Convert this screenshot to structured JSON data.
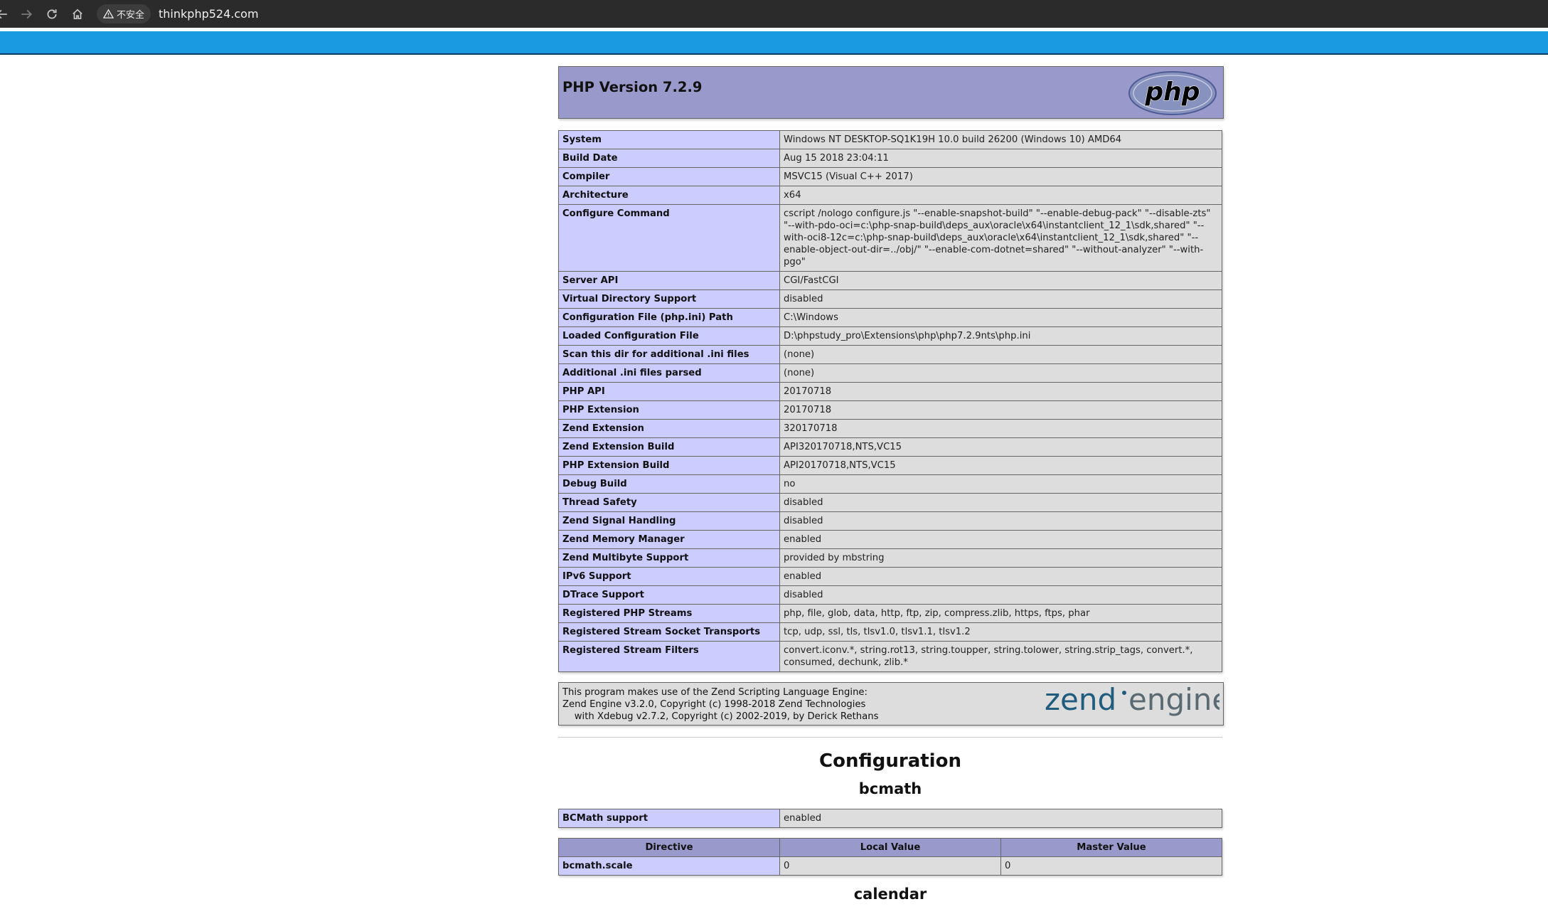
{
  "browser": {
    "security_label": "不安全",
    "url": "thinkphp524.com"
  },
  "header": {
    "title": "PHP Version 7.2.9",
    "logo_text": "php"
  },
  "system_rows": [
    {
      "key": "System",
      "value": "Windows NT DESKTOP-SQ1K19H 10.0 build 26200 (Windows 10) AMD64"
    },
    {
      "key": "Build Date",
      "value": "Aug 15 2018 23:04:11"
    },
    {
      "key": "Compiler",
      "value": "MSVC15 (Visual C++ 2017)"
    },
    {
      "key": "Architecture",
      "value": "x64"
    },
    {
      "key": "Configure Command",
      "value": "cscript /nologo configure.js \"--enable-snapshot-build\" \"--enable-debug-pack\" \"--disable-zts\" \"--with-pdo-oci=c:\\php-snap-build\\deps_aux\\oracle\\x64\\instantclient_12_1\\sdk,shared\" \"--with-oci8-12c=c:\\php-snap-build\\deps_aux\\oracle\\x64\\instantclient_12_1\\sdk,shared\" \"--enable-object-out-dir=../obj/\" \"--enable-com-dotnet=shared\" \"--without-analyzer\" \"--with-pgo\""
    },
    {
      "key": "Server API",
      "value": "CGI/FastCGI"
    },
    {
      "key": "Virtual Directory Support",
      "value": "disabled"
    },
    {
      "key": "Configuration File (php.ini) Path",
      "value": "C:\\Windows"
    },
    {
      "key": "Loaded Configuration File",
      "value": "D:\\phpstudy_pro\\Extensions\\php\\php7.2.9nts\\php.ini"
    },
    {
      "key": "Scan this dir for additional .ini files",
      "value": "(none)"
    },
    {
      "key": "Additional .ini files parsed",
      "value": "(none)"
    },
    {
      "key": "PHP API",
      "value": "20170718"
    },
    {
      "key": "PHP Extension",
      "value": "20170718"
    },
    {
      "key": "Zend Extension",
      "value": "320170718"
    },
    {
      "key": "Zend Extension Build",
      "value": "API320170718,NTS,VC15"
    },
    {
      "key": "PHP Extension Build",
      "value": "API20170718,NTS,VC15"
    },
    {
      "key": "Debug Build",
      "value": "no"
    },
    {
      "key": "Thread Safety",
      "value": "disabled"
    },
    {
      "key": "Zend Signal Handling",
      "value": "disabled"
    },
    {
      "key": "Zend Memory Manager",
      "value": "enabled"
    },
    {
      "key": "Zend Multibyte Support",
      "value": "provided by mbstring"
    },
    {
      "key": "IPv6 Support",
      "value": "enabled"
    },
    {
      "key": "DTrace Support",
      "value": "disabled"
    },
    {
      "key": "Registered PHP Streams",
      "value": "php, file, glob, data, http, ftp, zip, compress.zlib, https, ftps, phar"
    },
    {
      "key": "Registered Stream Socket Transports",
      "value": "tcp, udp, ssl, tls, tlsv1.0, tlsv1.1, tlsv1.2"
    },
    {
      "key": "Registered Stream Filters",
      "value": "convert.iconv.*, string.rot13, string.toupper, string.tolower, string.strip_tags, convert.*, consumed, dechunk, zlib.*"
    }
  ],
  "zend": {
    "lines": [
      "This program makes use of the Zend Scripting Language Engine:",
      "Zend Engine v3.2.0, Copyright (c) 1998-2018 Zend Technologies",
      "    with Xdebug v2.7.2, Copyright (c) 2002-2019, by Derick Rethans"
    ],
    "logo_text_left": "zend",
    "logo_text_right": "engine"
  },
  "configuration": {
    "title": "Configuration",
    "module_title": "bcmath",
    "support": {
      "key": "BCMath support",
      "value": "enabled"
    },
    "directive_headers": [
      "Directive",
      "Local Value",
      "Master Value"
    ],
    "directives": [
      {
        "name": "bcmath.scale",
        "local": "0",
        "master": "0"
      }
    ],
    "next_module_title": "calendar"
  },
  "colors": {
    "header_purple": "#9999cc",
    "key_lavender": "#ccccff",
    "value_gray": "#dddddd",
    "browser_accent": "#1a9ae0"
  }
}
